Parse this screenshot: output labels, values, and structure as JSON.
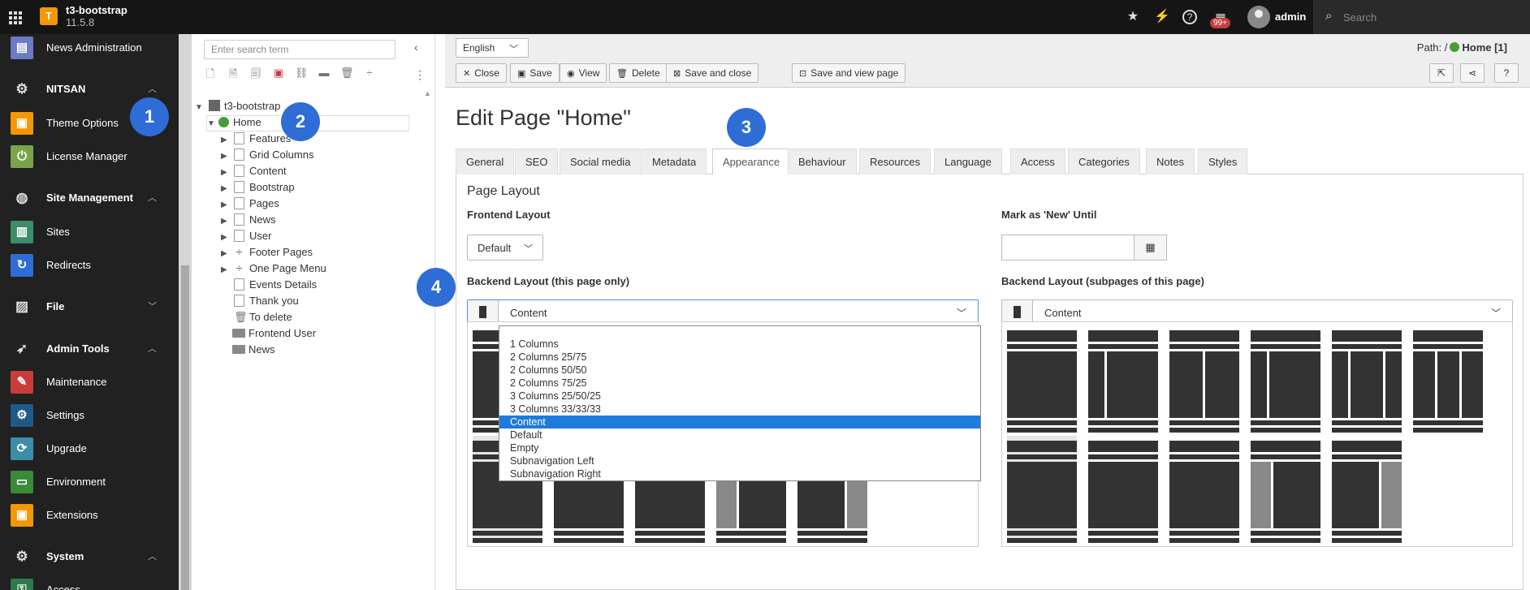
{
  "topbar": {
    "site_name": "t3-bootstrap",
    "version": "11.5.8",
    "badge": "99+",
    "user": "admin",
    "search_placeholder": "Search",
    "icons": [
      "star-icon",
      "bolt-icon",
      "help-icon",
      "calendar-icon"
    ]
  },
  "sidebar": {
    "items": [
      {
        "label": "News Administration",
        "icon": "news-icon",
        "color": "#6b7cc4"
      },
      {
        "label": "NITSAN",
        "icon": "gear-icon",
        "group": true
      },
      {
        "label": "Theme Options",
        "icon": "box-icon",
        "color": "#f49700"
      },
      {
        "label": "License Manager",
        "icon": "power-icon",
        "color": "#79a548"
      },
      {
        "label": "Site Management",
        "icon": "globe-icon",
        "group": true
      },
      {
        "label": "Sites",
        "icon": "sites-icon",
        "color": "#3d8c6a"
      },
      {
        "label": "Redirects",
        "icon": "redirect-icon",
        "color": "#2e6dd6"
      },
      {
        "label": "File",
        "icon": "image-icon",
        "group": true
      },
      {
        "label": "Admin Tools",
        "icon": "rocket-icon",
        "group": true
      },
      {
        "label": "Maintenance",
        "icon": "wrench-icon",
        "color": "#c83c3c"
      },
      {
        "label": "Settings",
        "icon": "gear-icon",
        "color": "#1d5a8a"
      },
      {
        "label": "Upgrade",
        "icon": "upgrade-icon",
        "color": "#3b8ea5"
      },
      {
        "label": "Environment",
        "icon": "monitor-icon",
        "color": "#3a8a3a"
      },
      {
        "label": "Extensions",
        "icon": "box-icon",
        "color": "#f49700"
      },
      {
        "label": "System",
        "icon": "gear-icon",
        "group": true
      },
      {
        "label": "Access",
        "icon": "access-icon",
        "color": "#2d7a4d"
      }
    ]
  },
  "tree": {
    "filter_placeholder": "Enter search term",
    "root": "t3-bootstrap",
    "home": "Home",
    "children": [
      "Features",
      "Grid Columns",
      "Content",
      "Bootstrap",
      "Pages",
      "News",
      "User",
      "Footer Pages",
      "One Page Menu",
      "Events Details",
      "Thank you",
      "To delete",
      "Frontend User",
      "News"
    ]
  },
  "docheader": {
    "language": "English",
    "path_label": "Path: /",
    "path_page": "Home [1]",
    "buttons": {
      "close": "Close",
      "save": "Save",
      "view": "View",
      "delete": "Delete",
      "save_close": "Save and close",
      "save_view": "Save and view page"
    }
  },
  "page": {
    "title": "Edit Page \"Home\"",
    "tabs": [
      "General",
      "SEO",
      "Social media",
      "Metadata",
      "Appearance",
      "Behaviour",
      "Resources",
      "Language",
      "Access",
      "Categories",
      "Notes",
      "Styles"
    ],
    "active_tab": "Appearance",
    "section": "Page Layout",
    "frontend_layout_label": "Frontend Layout",
    "frontend_layout_value": "Default",
    "new_until_label": "Mark as 'New' Until",
    "backend_layout_label": "Backend Layout (this page only)",
    "backend_layout_value": "Content",
    "backend_sub_label": "Backend Layout (subpages of this page)",
    "backend_sub_value": "Content",
    "options": [
      "1 Columns",
      "2 Columns 25/75",
      "2 Columns 50/50",
      "2 Columns 75/25",
      "3 Columns 25/50/25",
      "3 Columns 33/33/33",
      "Content",
      "Default",
      "Empty",
      "Subnavigation Left",
      "Subnavigation Right"
    ],
    "selected_option": "Content"
  },
  "steps": [
    "1",
    "2",
    "3",
    "4"
  ]
}
